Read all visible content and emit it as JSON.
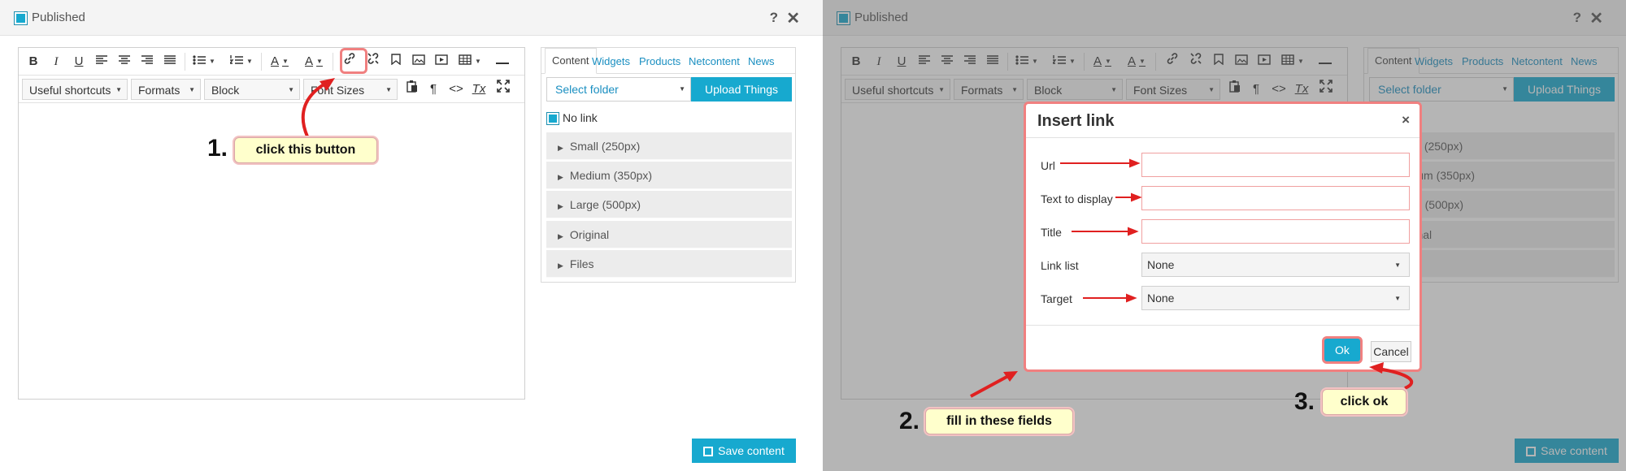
{
  "window": {
    "title": "Published",
    "help_label": "?",
    "close_label": "✕"
  },
  "toolbar_row1": {
    "bold": "B",
    "italic": "I",
    "underline": "U",
    "align_left_icon": "align-left",
    "align_center_icon": "align-center",
    "align_right_icon": "align-right",
    "justify_icon": "justify",
    "bullet_list_icon": "bullet-list",
    "numbered_list_icon": "numbered-list",
    "text_color": "A",
    "background_color": "A",
    "link_icon": "link",
    "unlink_icon": "unlink",
    "anchor_icon": "bookmark",
    "image_icon": "image",
    "media_icon": "media",
    "table_icon": "table",
    "hr_icon": "horizontal-rule"
  },
  "toolbar_row2": {
    "shortcuts": "Useful shortcuts",
    "formats": "Formats",
    "block": "Block",
    "font_sizes": "Font Sizes",
    "paste_icon": "paste",
    "pilcrow": "¶",
    "code": "<>",
    "clear_format": "Tx",
    "fullscreen_icon": "fullscreen"
  },
  "side_panel": {
    "tabs": [
      "Content",
      "Widgets",
      "Products",
      "Netcontent",
      "News"
    ],
    "folder_placeholder": "Select folder",
    "upload_label": "Upload Things",
    "no_link_label": "No link",
    "items": [
      "Small (250px)",
      "Medium (350px)",
      "Large (500px)",
      "Original",
      "Files"
    ]
  },
  "save_label": "Save content",
  "dialog": {
    "title": "Insert link",
    "close": "×",
    "fields": {
      "url": "Url",
      "text": "Text to display",
      "title": "Title",
      "link_list": "Link list",
      "target": "Target"
    },
    "link_list_value": "None",
    "target_value": "None",
    "ok_label": "Ok",
    "cancel_label": "Cancel"
  },
  "annotations": {
    "step1_num": "1.",
    "step1_text": "click this button",
    "step2_num": "2.",
    "step2_text": "fill in these fields",
    "step3_num": "3.",
    "step3_text": "click ok",
    "accent_color": "#e02020",
    "callout_color": "#ffffcc"
  },
  "colors": {
    "brand": "#17a9cf",
    "tab_link": "#1a8fc1",
    "highlight": "#f08080"
  }
}
